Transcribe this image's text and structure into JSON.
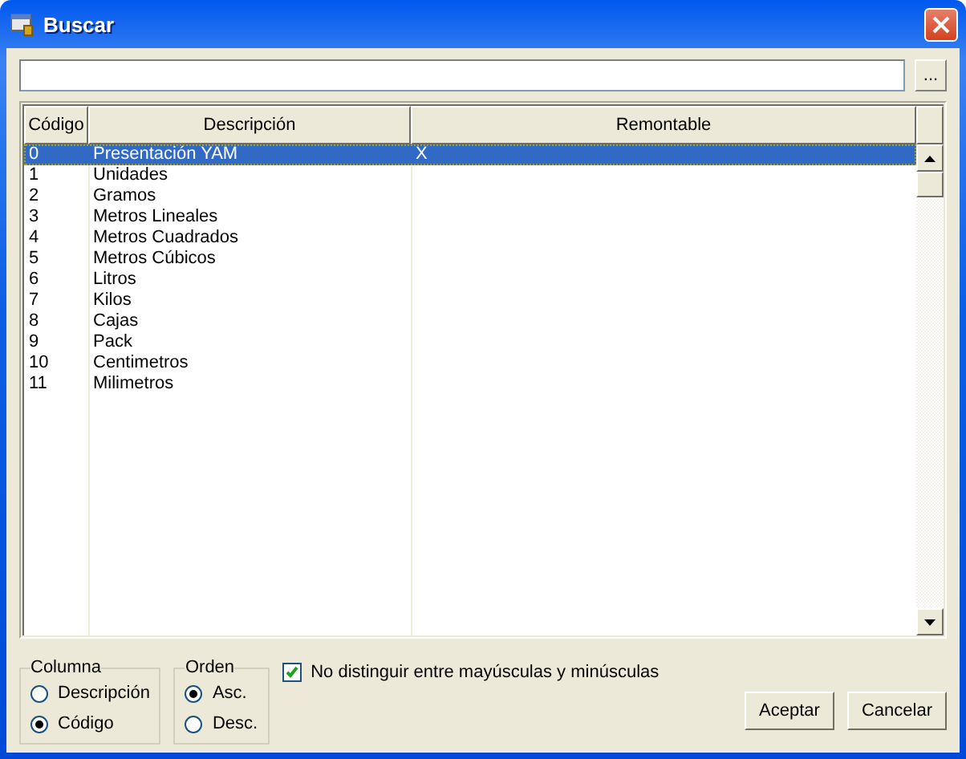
{
  "window": {
    "title": "Buscar"
  },
  "search": {
    "browse_button": "..."
  },
  "table": {
    "columns": [
      "Código",
      "Descripción",
      "Remontable"
    ],
    "rows": [
      {
        "codigo": "0",
        "descripcion": "Presentación YAM",
        "remontable": "X",
        "selected": true
      },
      {
        "codigo": "1",
        "descripcion": "Unidades",
        "selected": false
      },
      {
        "codigo": "2",
        "descripcion": "Gramos",
        "selected": false
      },
      {
        "codigo": "3",
        "descripcion": "Metros Lineales",
        "selected": false
      },
      {
        "codigo": "4",
        "descripcion": "Metros Cuadrados",
        "selected": false
      },
      {
        "codigo": "5",
        "descripcion": "Metros Cúbicos",
        "selected": false
      },
      {
        "codigo": "6",
        "descripcion": "Litros",
        "selected": false
      },
      {
        "codigo": "7",
        "descripcion": "Kilos",
        "selected": false
      },
      {
        "codigo": "8",
        "descripcion": "Cajas",
        "selected": false
      },
      {
        "codigo": "9",
        "descripcion": "Pack",
        "selected": false
      },
      {
        "codigo": "10",
        "descripcion": "Centimetros",
        "selected": false
      },
      {
        "codigo": "11",
        "descripcion": "Milimetros",
        "selected": false
      }
    ]
  },
  "columna": {
    "label": "Columna",
    "options": [
      {
        "label": "Descripción",
        "selected": false
      },
      {
        "label": "Código",
        "selected": true
      }
    ]
  },
  "orden": {
    "label": "Orden",
    "options": [
      {
        "label": "Asc.",
        "selected": true
      },
      {
        "label": "Desc.",
        "selected": false
      }
    ]
  },
  "case_checkbox": {
    "label": "No distinguir entre mayúsculas y minúsculas",
    "checked": true
  },
  "buttons": [
    "Aceptar",
    "Cancelar"
  ]
}
